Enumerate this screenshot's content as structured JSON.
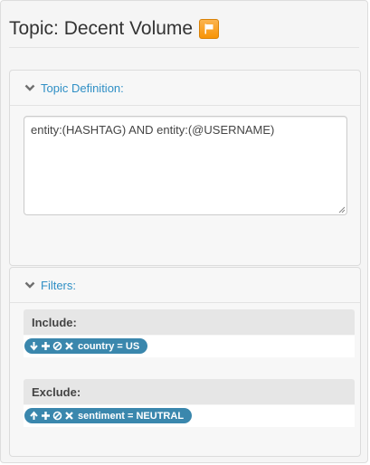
{
  "topic": {
    "title": "Topic: Decent Volume",
    "flag_color": "#f89406",
    "flag_icon": "flag-icon"
  },
  "definition": {
    "header": "Topic Definition:",
    "header_icon": "chevron-down-icon",
    "query": "entity:(HASHTAG) AND entity:(@USERNAME)"
  },
  "filters": {
    "header": "Filters:",
    "header_icon": "chevron-down-icon",
    "include": {
      "label": "Include:",
      "pills": [
        {
          "text": "country = US",
          "icons": [
            "arrow-down-icon",
            "plus-icon",
            "ban-icon",
            "remove-icon"
          ]
        }
      ]
    },
    "exclude": {
      "label": "Exclude:",
      "pills": [
        {
          "text": "sentiment = NEUTRAL",
          "icons": [
            "arrow-up-icon",
            "plus-icon",
            "ban-icon",
            "remove-icon"
          ]
        }
      ]
    }
  },
  "colors": {
    "link": "#2f8fc5",
    "pill": "#3a87ad",
    "flag": "#f89406"
  }
}
